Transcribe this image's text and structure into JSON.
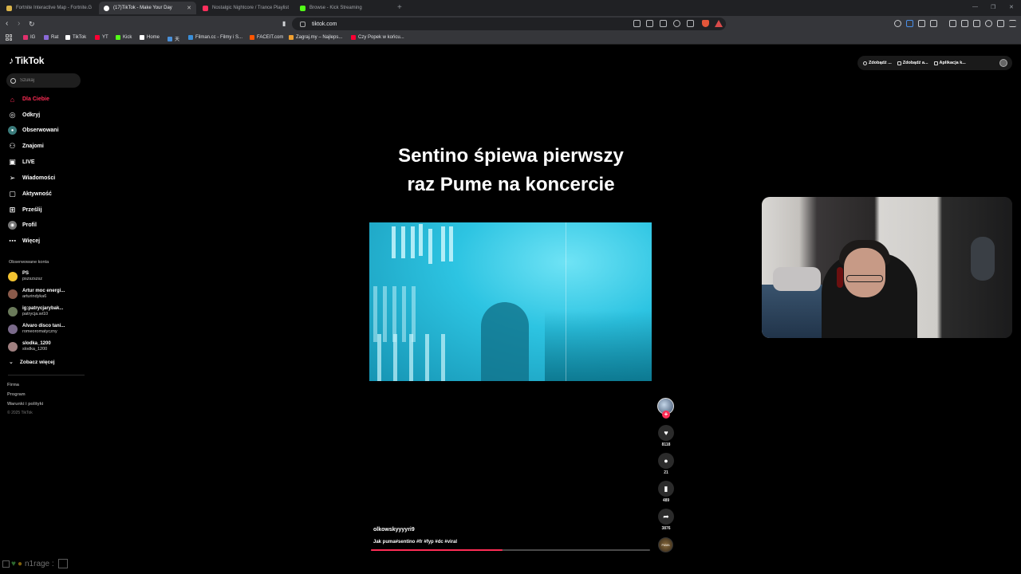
{
  "browser": {
    "tabs": [
      {
        "title": "Fortnite Interactive Map - Fortnite.G",
        "favicon_color": "#d9b34a"
      },
      {
        "title": "(17)TikTok - Make Your Day",
        "favicon_color": "#ffffff"
      },
      {
        "title": "Nostalgic Nightcore / Trance Playlist",
        "favicon_color": "#ff2f5c"
      },
      {
        "title": "Browse - Kick Streaming",
        "favicon_color": "#53fc18"
      }
    ],
    "url": "tiktok.com",
    "bookmarks": [
      {
        "label": "IG",
        "color": "#e1306c"
      },
      {
        "label": "Rat",
        "color": "#8a6ad8"
      },
      {
        "label": "TikTok",
        "color": "#ffffff"
      },
      {
        "label": "YT",
        "color": "#ff0033"
      },
      {
        "label": "Kick",
        "color": "#53fc18"
      },
      {
        "label": "Home",
        "color": "#ffffff"
      },
      {
        "label": "天",
        "color": "#4a90d9"
      },
      {
        "label": "Filman.cc - Filmy i S...",
        "color": "#3a8fd9"
      },
      {
        "label": "FACEIT.com",
        "color": "#ff5500"
      },
      {
        "label": "Zagraj.my – Najleps...",
        "color": "#f0a030"
      },
      {
        "label": "Czy Popek w końcu...",
        "color": "#ff0033"
      }
    ]
  },
  "tiktok": {
    "logo": "TikTok",
    "search_placeholder": "Szukaj",
    "nav": [
      {
        "label": "Dla Ciebie",
        "icon": "home-icon",
        "active": true
      },
      {
        "label": "Odkryj",
        "icon": "compass-icon"
      },
      {
        "label": "Obserwowani",
        "icon": "following-icon"
      },
      {
        "label": "Znajomi",
        "icon": "friends-icon"
      },
      {
        "label": "LIVE",
        "icon": "live-icon"
      },
      {
        "label": "Wiadomości",
        "icon": "messages-icon"
      },
      {
        "label": "Aktywność",
        "icon": "activity-icon"
      },
      {
        "label": "Prześlij",
        "icon": "upload-icon"
      },
      {
        "label": "Profil",
        "icon": "profile-icon"
      },
      {
        "label": "Więcej",
        "icon": "more-icon"
      }
    ],
    "followed_label": "Obserwowane konta",
    "followed": [
      {
        "name": "PS",
        "handle": "pszszszsz",
        "color": "#f2c230"
      },
      {
        "name": "Artur moc energi...",
        "handle": "arturindyka6",
        "color": "#8a5a4a"
      },
      {
        "name": "ig:patrycjarybak...",
        "handle": "patrycja.wi10",
        "color": "#6a7a5a"
      },
      {
        "name": "Alvaro disco tani...",
        "handle": "romeoromatyczny",
        "color": "#7a6a8a"
      },
      {
        "name": "slodka_1200",
        "handle": "slodka_1200",
        "color": "#a08080"
      }
    ],
    "see_more": "Zobacz więcej",
    "footer": [
      "Firma",
      "Program",
      "Warunki i polityki"
    ],
    "copyright": "© 2025 TikTok",
    "top_right": [
      "Zdobądź ...",
      "Zdobądź a...",
      "Aplikacja k..."
    ],
    "video": {
      "title_line1": "Sentino śpiewa pierwszy",
      "title_line2": "raz Pume na koncercie",
      "username": "olkowskyyyyri9",
      "caption": "Jak puma#sentino #fr #fyp #dc #viral",
      "progress": 0.47,
      "likes": "8118",
      "comments": "21",
      "saves": "489",
      "shares": "3876",
      "disc_label": "PUMA"
    }
  },
  "overlay": {
    "text": "n1rage :"
  }
}
